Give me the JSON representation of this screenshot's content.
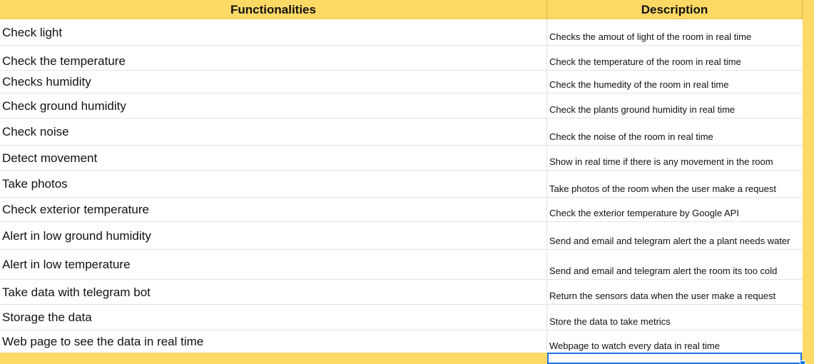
{
  "header": {
    "functionalities": "Functionalities",
    "description": "Description"
  },
  "rows": [
    {
      "func": "Check light",
      "desc": "Checks the amout of light of the room in real time"
    },
    {
      "func": "Check the temperature",
      "desc": "Check the temperature of the room in real time"
    },
    {
      "func": "Checks humidity",
      "desc": "Check the humedity of the room in real time"
    },
    {
      "func": "Check ground humidity",
      "desc": "Check the plants ground humidity in real time"
    },
    {
      "func": "Check noise",
      "desc": "Check the noise of the room in real time"
    },
    {
      "func": "Detect movement",
      "desc": "Show in real time if there is any movement in the room"
    },
    {
      "func": "Take photos",
      "desc": "Take photos of the room when the user make a request"
    },
    {
      "func": "Check exterior temperature",
      "desc": "Check the exterior temperature by Google API"
    },
    {
      "func": "Alert in low ground humidity",
      "desc": "Send and email and telegram alert the a plant needs water"
    },
    {
      "func": "Alert in low temperature",
      "desc": "Send and email and telegram alert the room its too cold"
    },
    {
      "func": "Take data with telegram bot",
      "desc": "Return the sensors data when the user make a request"
    },
    {
      "func": "Storage the data",
      "desc": "Store the data to take metrics"
    },
    {
      "func": "Web page to see the data in real time",
      "desc": "Webpage to watch every data in real time"
    }
  ],
  "colors": {
    "header_bg": "#ffd966",
    "selection": "#1a73e8",
    "gridline": "#e3e3e3"
  }
}
